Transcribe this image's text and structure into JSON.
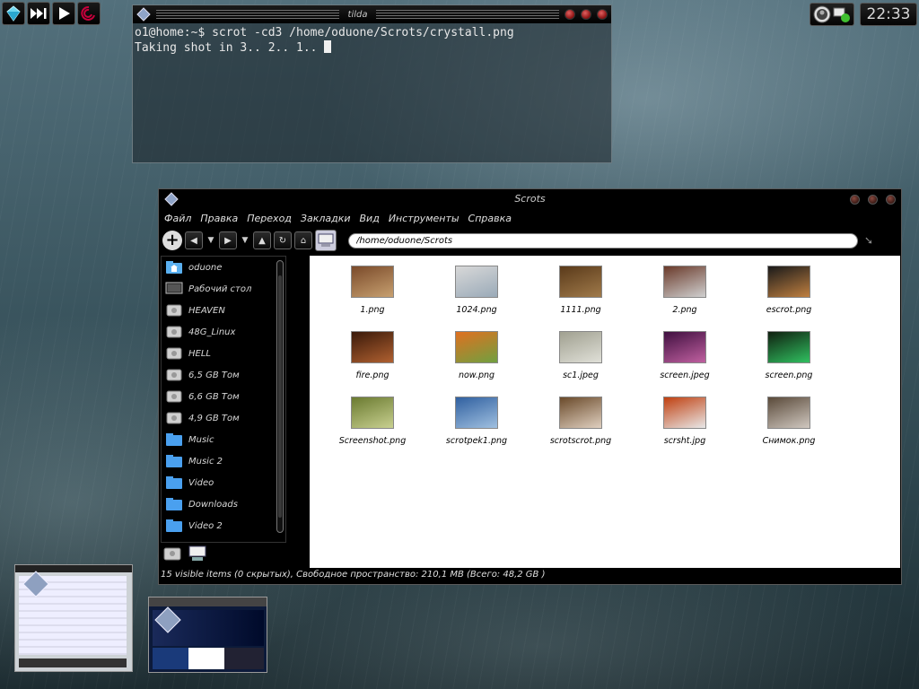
{
  "desktop": {
    "panel_left": {
      "icons": [
        "diamond-icon",
        "skip-forward-icon",
        "play-icon",
        "debian-swirl-icon"
      ]
    },
    "tray": {
      "icons": [
        "avatar-icon",
        "network-icon"
      ]
    },
    "clock": "22:33"
  },
  "terminal": {
    "title": "tilda",
    "lines": [
      "o1@home:~$ scrot -cd3 /home/oduone/Scrots/crystall.png",
      "Taking shot in 3.. 2.. 1.. "
    ]
  },
  "file_manager": {
    "title": "Scrots",
    "menu": [
      "Файл",
      "Правка",
      "Переход",
      "Закладки",
      "Вид",
      "Инструменты",
      "Справка"
    ],
    "path": "/home/oduone/Scrots",
    "sidebar": [
      {
        "label": "oduone",
        "icon": "home-folder-icon"
      },
      {
        "label": "Рабочий стол",
        "icon": "desktop-icon"
      },
      {
        "label": "HEAVEN",
        "icon": "drive-icon"
      },
      {
        "label": "48G_Linux",
        "icon": "drive-icon"
      },
      {
        "label": "HELL",
        "icon": "drive-icon"
      },
      {
        "label": "6,5 GB Том",
        "icon": "drive-icon"
      },
      {
        "label": "6,6 GB Том",
        "icon": "drive-icon"
      },
      {
        "label": "4,9 GB Том",
        "icon": "drive-icon"
      },
      {
        "label": "Music",
        "icon": "folder-icon"
      },
      {
        "label": "Music 2",
        "icon": "folder-icon"
      },
      {
        "label": "Video",
        "icon": "folder-icon"
      },
      {
        "label": "Downloads",
        "icon": "folder-icon"
      },
      {
        "label": "Video 2",
        "icon": "folder-icon"
      }
    ],
    "files": [
      {
        "name": "1.png",
        "colors": [
          "#7a4a2a",
          "#c7a070"
        ]
      },
      {
        "name": "1024.png",
        "colors": [
          "#d8d8d8",
          "#9aaab8"
        ]
      },
      {
        "name": "1111.png",
        "colors": [
          "#5a3a1a",
          "#a07a4a"
        ]
      },
      {
        "name": "2.png",
        "colors": [
          "#6a3a2a",
          "#d0d0d0"
        ]
      },
      {
        "name": "escrot.png",
        "colors": [
          "#1a1a1a",
          "#c08040"
        ]
      },
      {
        "name": "fire.png",
        "colors": [
          "#3a1a0a",
          "#b06030"
        ]
      },
      {
        "name": "now.png",
        "colors": [
          "#e07020",
          "#70a040"
        ]
      },
      {
        "name": "sc1.jpeg",
        "colors": [
          "#a0a090",
          "#e0e0d8"
        ]
      },
      {
        "name": "screen.jpeg",
        "colors": [
          "#401040",
          "#c060a0"
        ]
      },
      {
        "name": "screen.png",
        "colors": [
          "#102010",
          "#30c060"
        ]
      },
      {
        "name": "Screenshot.png",
        "colors": [
          "#6a7a30",
          "#c8d090"
        ]
      },
      {
        "name": "scrotpek1.png",
        "colors": [
          "#3060a0",
          "#a0c0e0"
        ]
      },
      {
        "name": "scrotscrot.png",
        "colors": [
          "#6a4a2a",
          "#e0d0c0"
        ]
      },
      {
        "name": "scrsht.jpg",
        "colors": [
          "#c04010",
          "#e8e8e8"
        ]
      },
      {
        "name": "Снимок.png",
        "colors": [
          "#5a4a3a",
          "#d0c8c0"
        ]
      }
    ],
    "status": "15 visible items (0 скрытых), Свободное пространство: 210,1 MB (Всего: 48,2 GB )"
  }
}
